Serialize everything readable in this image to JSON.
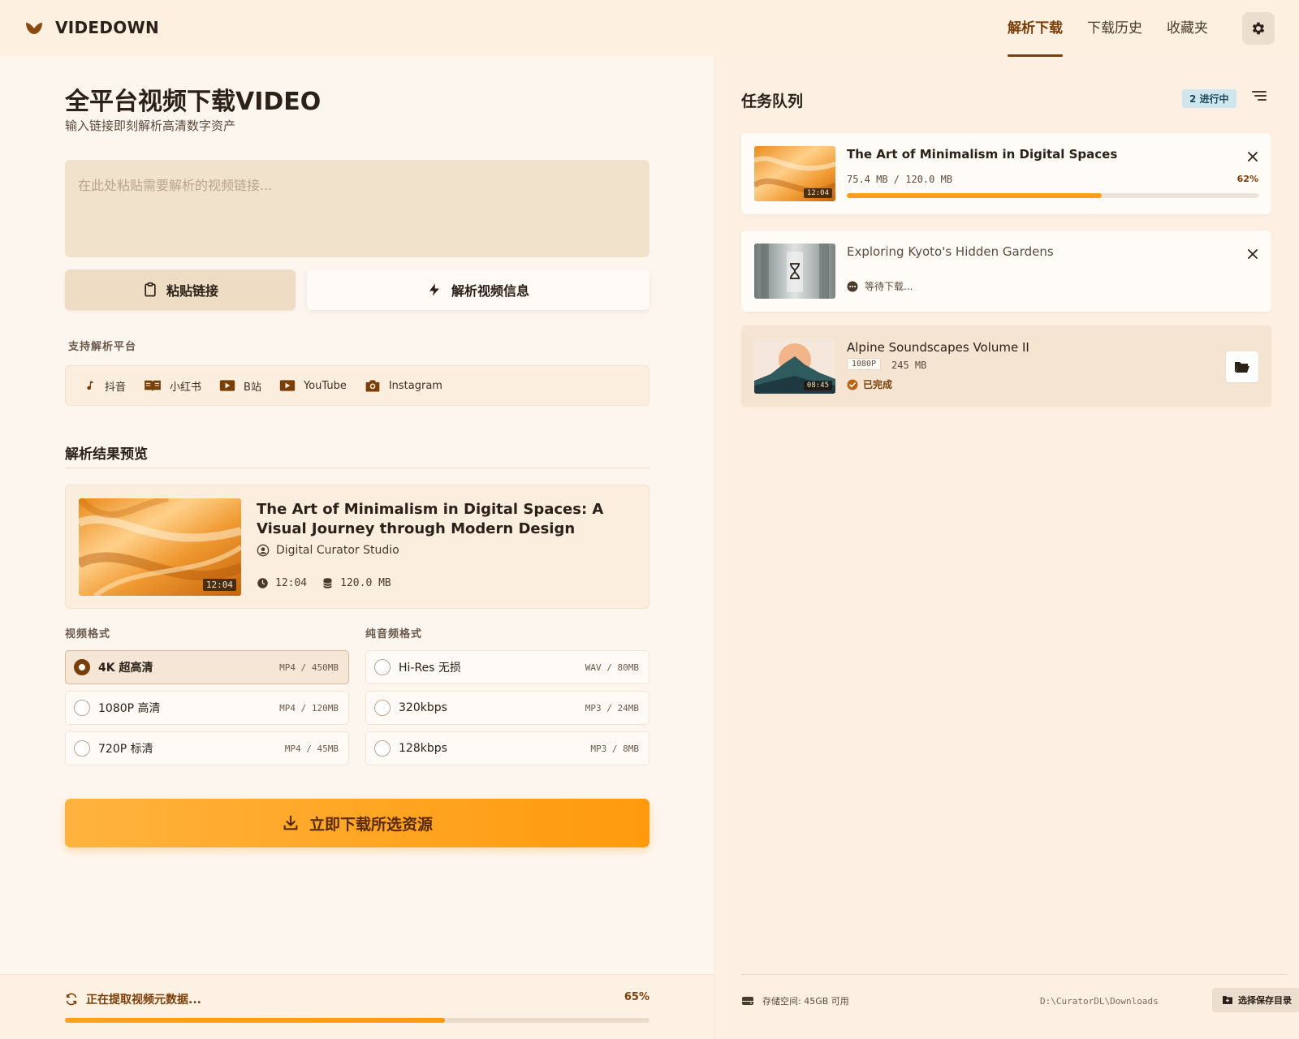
{
  "app": {
    "brand": "VIDEDOWN"
  },
  "nav": {
    "items": [
      {
        "label": "解析下载",
        "active": true
      },
      {
        "label": "下载历史",
        "active": false
      },
      {
        "label": "收藏夹",
        "active": false
      }
    ]
  },
  "main": {
    "title": "全平台视频下载VIDEO",
    "subtitle": "输入链接即刻解析高清数字资产",
    "url_placeholder": "在此处粘贴需要解析的视频链接...",
    "paste_label": "粘贴链接",
    "parse_label": "解析视频信息",
    "platforms_label": "支持解析平台",
    "platforms": [
      {
        "name": "抖音",
        "icon": "music-note-icon"
      },
      {
        "name": "小红书",
        "icon": "book-icon"
      },
      {
        "name": "B站",
        "icon": "play-icon"
      },
      {
        "name": "YouTube",
        "icon": "play-icon"
      },
      {
        "name": "Instagram",
        "icon": "camera-icon"
      }
    ],
    "results_title": "解析结果预览",
    "preview": {
      "title": "The Art of Minimalism in Digital Spaces: A Visual Journey through Modern Design",
      "author": "Digital Curator Studio",
      "duration": "12:04",
      "size": "120.0 MB"
    },
    "video_formats_label": "视频格式",
    "audio_formats_label": "纯音频格式",
    "video_formats": [
      {
        "name": "4K 超高清",
        "spec": "MP4 / 450MB",
        "selected": true
      },
      {
        "name": "1080P 高清",
        "spec": "MP4 / 120MB",
        "selected": false
      },
      {
        "name": "720P 标清",
        "spec": "MP4 / 45MB",
        "selected": false
      }
    ],
    "audio_formats": [
      {
        "name": "Hi-Res 无损",
        "spec": "WAV / 80MB",
        "selected": false
      },
      {
        "name": "320kbps",
        "spec": "MP3 / 24MB",
        "selected": false
      },
      {
        "name": "128kbps",
        "spec": "MP3 / 8MB",
        "selected": false
      }
    ],
    "download_label": "立即下载所选资源"
  },
  "footer": {
    "status": "正在提取视频元数据...",
    "percent_label": "65%",
    "progress": 0.65
  },
  "queue": {
    "title": "任务队列",
    "badge": "2 进行中",
    "tasks": [
      {
        "title": "The Art of Minimalism in Digital Spaces",
        "duration": "12:04",
        "size": "75.4 MB / 120.0 MB",
        "percent_label": "62%",
        "progress": 0.62
      },
      {
        "title": "Exploring Kyoto's Hidden Gardens",
        "status": "等待下载..."
      },
      {
        "title": "Alpine Soundscapes Volume II",
        "resolution": "1080P",
        "size": "245 MB",
        "duration": "08:45",
        "status": "已完成"
      }
    ],
    "storage_label": "存储空间: 45GB 可用",
    "save_path": "D:\\CuratorDL\\Downloads",
    "choose_dir_label": "选择保存目录"
  },
  "colors": {
    "accent": "#7a3e08",
    "orange": "#ff9f18",
    "background": "#fdf3e7"
  }
}
